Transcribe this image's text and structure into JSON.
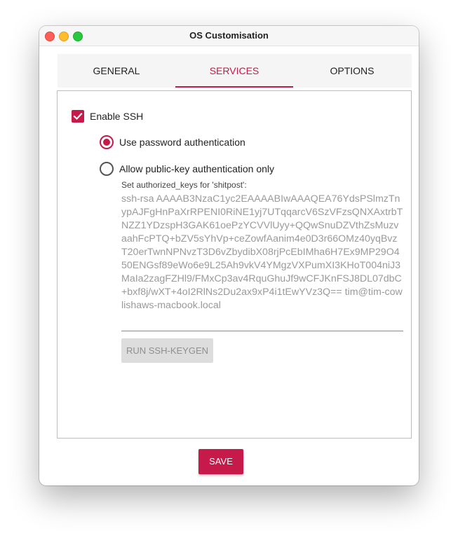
{
  "window": {
    "title": "OS Customisation"
  },
  "tabs": [
    {
      "label": "GENERAL",
      "active": false
    },
    {
      "label": "SERVICES",
      "active": true
    },
    {
      "label": "OPTIONS",
      "active": false
    }
  ],
  "services": {
    "enable_ssh": {
      "label": "Enable SSH",
      "checked": true
    },
    "auth_options": [
      {
        "label": "Use password authentication",
        "selected": true
      },
      {
        "label": "Allow public-key authentication only",
        "selected": false
      }
    ],
    "authorized_keys": {
      "caption": "Set authorized_keys for 'shitpost':",
      "value": "ssh-rsa AAAAB3NzaC1yc2EAAAABIwAAAQEA76YdsPSlmzTnypAJFgHnPaXrRPENI0RiNE1yj7UTqqarcV6SzVFzsQNXAxtrbTNZZ1YDzspH3GAK61oePzYCVVlUyy+QQwSnuDZVthZsMuzvaahFcPTQ+bZV5sYhVp+ceZowfAanim4e0D3r66OMz40yqBvzT20erTwnNPNvzT3D6vZbydibX08rjPcEbIMha6H7Ex9MP29O450ENGsf89eWo6e9L25Ah9vkV4YMgzVXPumXI3KHoT004niJ3MaIa2zagFZHl9/FMxCp3av4RquGhuJf9wCFJKnFSJ8DL07dbC+bxf8j/wXT+4oI2RlNs2Du2ax9xP4i1tEwYVz3Q== tim@tim-cowlishaws-macbook.local"
    },
    "keygen_button": "RUN SSH-KEYGEN"
  },
  "save_button": "SAVE",
  "colors": {
    "accent": "#c51a4a",
    "disabled_text": "#9a9a9a"
  }
}
